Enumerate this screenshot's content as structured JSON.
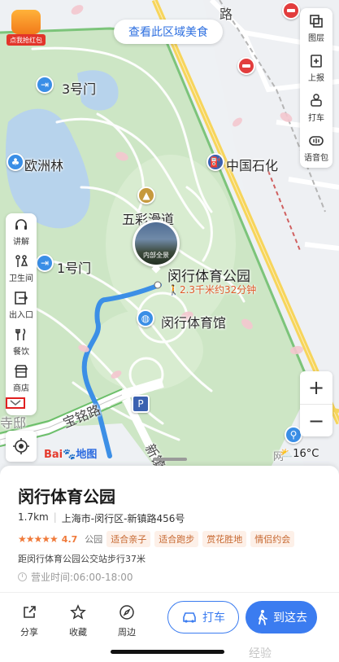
{
  "top_pill": {
    "label": "查看此区域美食"
  },
  "red_envelope": {
    "label": "点我抢红包"
  },
  "right_tools": [
    {
      "label": "图层",
      "icon": "layers-icon"
    },
    {
      "label": "上报",
      "icon": "report-icon"
    },
    {
      "label": "打车",
      "icon": "taxi-icon"
    },
    {
      "label": "语音包",
      "icon": "voice-pack-icon"
    }
  ],
  "left_tools": [
    {
      "label": "讲解",
      "icon": "headphones-icon"
    },
    {
      "label": "卫生间",
      "icon": "toilet-icon"
    },
    {
      "label": "出入口",
      "icon": "entrance-icon"
    },
    {
      "label": "餐饮",
      "icon": "dining-icon"
    },
    {
      "label": "商店",
      "icon": "shop-icon"
    }
  ],
  "map": {
    "labels": {
      "road_top": "路",
      "gate3": "3号门",
      "europe_forest": "欧洲林",
      "sinopec": "中国石化",
      "wucai": "五彩滑道",
      "gate1": "1号门",
      "stadium": "闵行体育馆",
      "baoming_road": "宝铭路",
      "xinzhen_road": "新镇",
      "residential": "寺邸",
      "wang": "网"
    },
    "photo_caption": "内部全景",
    "destination_title": "闵行体育公园",
    "destination_route": "2.3千米约32分钟",
    "weather": "16°C",
    "logo": {
      "left": "Bai",
      "right": "地图"
    },
    "zoom_in": "+",
    "zoom_out": "−"
  },
  "card": {
    "title": "闵行体育公园",
    "distance": "1.7km",
    "address": "上海市-闵行区-新镇路456号",
    "stars": "★★★★★",
    "rating": "4.7",
    "category": "公园",
    "tags": [
      "适合亲子",
      "适合跑步",
      "赏花胜地",
      "情侣约会"
    ],
    "transit": "距闵行体育公园公交站步行37米",
    "hours": "营业时间:06:00-18:00",
    "actions": [
      {
        "label": "分享",
        "icon": "share-icon"
      },
      {
        "label": "收藏",
        "icon": "star-icon"
      },
      {
        "label": "周边",
        "icon": "compass-icon"
      }
    ],
    "taxi_label": "打车",
    "go_label": "到这去",
    "watermark": "经验"
  },
  "colors": {
    "park_green": "#cfe8c6",
    "road_yellow": "#f7d55b",
    "route_blue": "#3c8fe6",
    "accent_blue": "#3b7cf0",
    "tag_bg": "#fdf0e8"
  }
}
